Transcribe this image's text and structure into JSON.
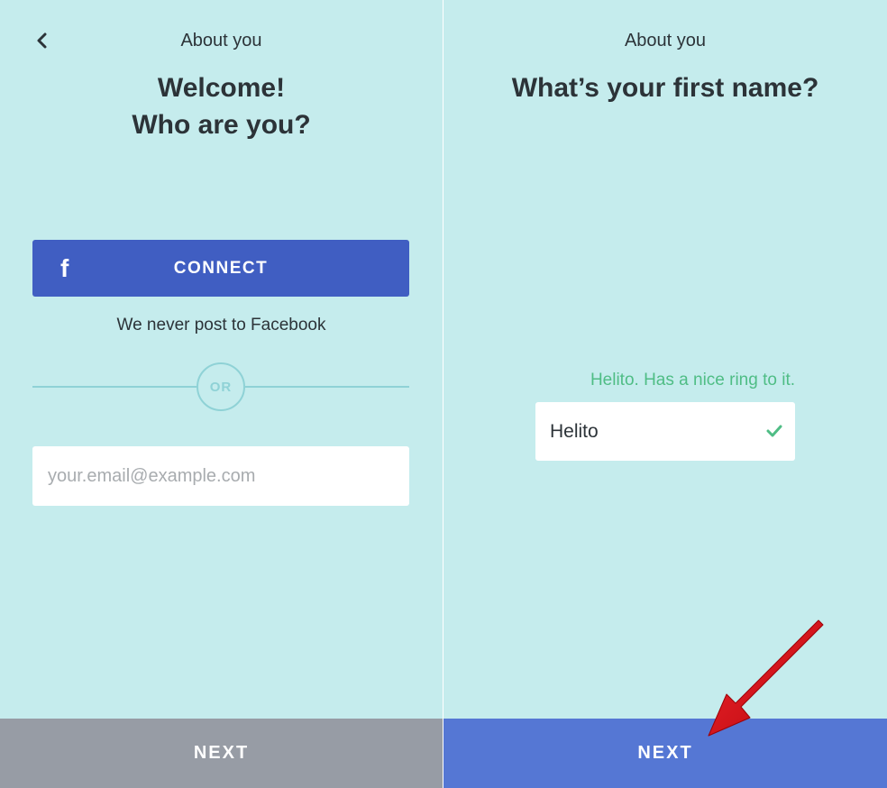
{
  "left": {
    "header_title": "About you",
    "heading_line1": "Welcome!",
    "heading_line2": "Who are you?",
    "facebook": {
      "icon_letter": "f",
      "button_label": "CONNECT",
      "note": "We never post to Facebook"
    },
    "separator_label": "OR",
    "email": {
      "value": "",
      "placeholder": "your.email@example.com"
    },
    "next_label": "NEXT"
  },
  "right": {
    "header_title": "About you",
    "heading": "What’s your first name?",
    "hint": "Helito. Has a nice ring to it.",
    "name_value": "Helito",
    "next_label": "NEXT"
  },
  "colors": {
    "background": "#c5eced",
    "facebook_blue": "#405ec2",
    "next_disabled": "#979ca5",
    "next_enabled": "#5577d4",
    "valid_green": "#4fbd85",
    "annotation_arrow": "#e3101a"
  },
  "icons": [
    "back-chevron-icon",
    "facebook-icon",
    "checkmark-icon",
    "red-arrow-annotation"
  ]
}
